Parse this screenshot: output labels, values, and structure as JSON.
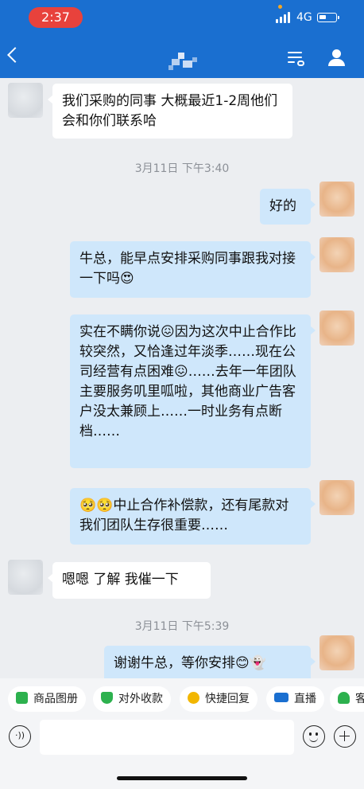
{
  "status_bar": {
    "time": "2:37",
    "network": "4G"
  },
  "nav": {
    "title": ""
  },
  "messages": [
    {
      "side": "in",
      "text": "我们采购的同事 大概最近1-2周他们会和你们联系哈"
    },
    {
      "type": "timestamp",
      "text": "3月11日 下午3:40"
    },
    {
      "side": "out",
      "text": "好的"
    },
    {
      "side": "out",
      "text": "牛总，能早点安排采购同事跟我对接一下吗😍"
    },
    {
      "side": "out",
      "text": "实在不瞒你说😖因为这次中止合作比较突然，又恰逢过年淡季……现在公司经营有点困难😖……去年一年团队主要服务叽里呱啦，其他商业广告客户没太兼顾上……一时业务有点断档……"
    },
    {
      "side": "out",
      "text": "🥺🥺中止合作补偿款，还有尾款对我们团队生存很重要……"
    },
    {
      "side": "in",
      "text": "嗯嗯 了解 我催一下"
    },
    {
      "type": "timestamp",
      "text": "3月11日 下午5:39"
    },
    {
      "side": "out",
      "text": "谢谢牛总，等你安排😊👻"
    }
  ],
  "quick_actions": [
    {
      "label": "商品图册",
      "icon": "catalog-icon",
      "color": "#2db14e"
    },
    {
      "label": "对外收款",
      "icon": "payment-shield-icon",
      "color": "#2db14e"
    },
    {
      "label": "快捷回复",
      "icon": "quick-reply-icon",
      "color": "#f2b600"
    },
    {
      "label": "直播",
      "icon": "live-icon",
      "color": "#1a6fd0"
    },
    {
      "label": "客",
      "icon": "customer-icon",
      "color": "#2db14e"
    }
  ],
  "input": {
    "placeholder": ""
  },
  "colors": {
    "brand_blue": "#1a6fd0",
    "outgoing_bubble": "#cfe7fb",
    "incoming_bubble": "#ffffff"
  }
}
